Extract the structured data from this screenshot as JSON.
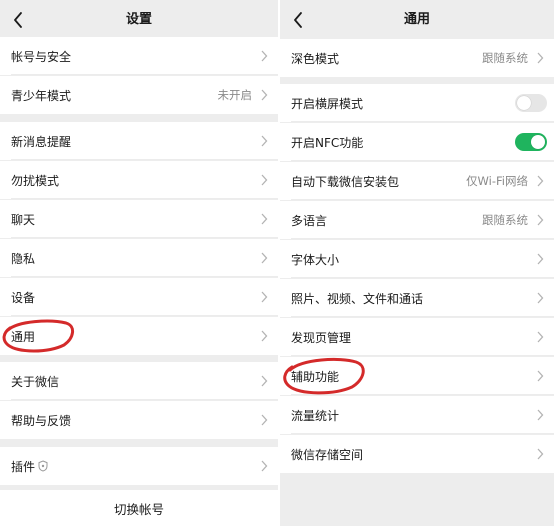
{
  "left": {
    "header": {
      "title": "设置"
    },
    "rows": [
      {
        "label": "帐号与安全"
      },
      {
        "label": "青少年模式",
        "value": "未开启"
      },
      {
        "label": "新消息提醒"
      },
      {
        "label": "勿扰模式"
      },
      {
        "label": "聊天"
      },
      {
        "label": "隐私"
      },
      {
        "label": "设备"
      },
      {
        "label": "通用"
      },
      {
        "label": "关于微信"
      },
      {
        "label": "帮助与反馈"
      },
      {
        "label": "插件"
      }
    ],
    "switch_account": "切换帐号"
  },
  "right": {
    "header": {
      "title": "通用"
    },
    "rows": [
      {
        "label": "深色模式",
        "value": "跟随系统"
      },
      {
        "label": "开启横屏模式",
        "toggle": "off"
      },
      {
        "label": "开启NFC功能",
        "toggle": "on"
      },
      {
        "label": "自动下载微信安装包",
        "value": "仅Wi-Fi网络"
      },
      {
        "label": "多语言",
        "value": "跟随系统"
      },
      {
        "label": "字体大小"
      },
      {
        "label": "照片、视频、文件和通话"
      },
      {
        "label": "发现页管理"
      },
      {
        "label": "辅助功能"
      },
      {
        "label": "流量统计"
      },
      {
        "label": "微信存储空间"
      }
    ]
  },
  "colors": {
    "background": "#ededed",
    "toggle_on": "#1fb45e",
    "toggle_off": "#e6e6e6",
    "annotation": "#d42a2a"
  },
  "icons": [
    "back-arrow-icon",
    "chevron-right-icon",
    "plugin-shield-icon"
  ]
}
